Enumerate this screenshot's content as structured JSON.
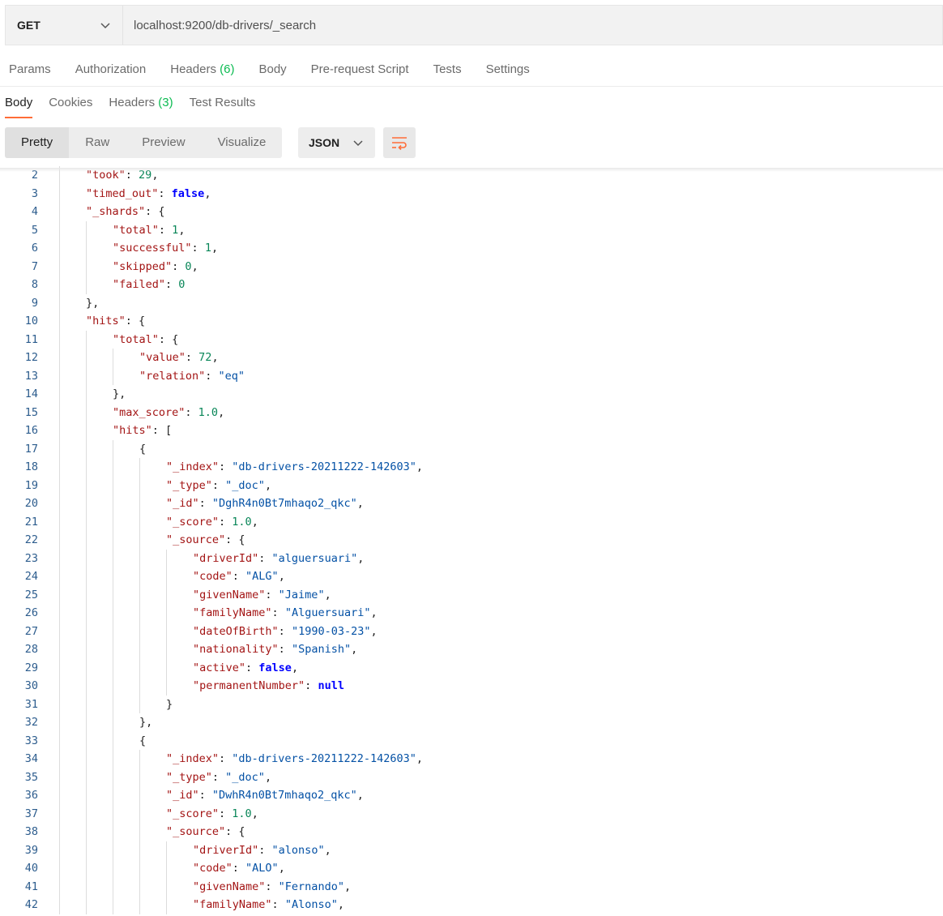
{
  "request": {
    "method": "GET",
    "url": "localhost:9200/db-drivers/_search",
    "tabs": [
      {
        "label": "Params",
        "count": ""
      },
      {
        "label": "Authorization",
        "count": ""
      },
      {
        "label": "Headers",
        "count": "(6)"
      },
      {
        "label": "Body",
        "count": ""
      },
      {
        "label": "Pre-request Script",
        "count": ""
      },
      {
        "label": "Tests",
        "count": ""
      },
      {
        "label": "Settings",
        "count": ""
      }
    ]
  },
  "response": {
    "tabs": [
      {
        "label": "Body",
        "count": "",
        "active": true
      },
      {
        "label": "Cookies",
        "count": "",
        "active": false
      },
      {
        "label": "Headers",
        "count": "(3)",
        "active": false
      },
      {
        "label": "Test Results",
        "count": "",
        "active": false
      }
    ],
    "views": [
      {
        "label": "Pretty",
        "active": true
      },
      {
        "label": "Raw",
        "active": false
      },
      {
        "label": "Preview",
        "active": false
      },
      {
        "label": "Visualize",
        "active": false
      }
    ],
    "format": "JSON"
  },
  "icons": {
    "method_dropdown": "chevron-down-icon",
    "format_dropdown": "chevron-down-icon",
    "wrap": "wrap-lines-icon"
  },
  "colors": {
    "accent": "#ff6c37",
    "count": "#0cbb52",
    "key": "#a31515",
    "string": "#0451a5",
    "number": "#098658",
    "keyword": "#0000ff",
    "line_number": "#2c5c8d"
  },
  "code_lines": [
    {
      "n": "2",
      "indent": 1,
      "tokens": [
        {
          "t": "k",
          "v": "\"took\""
        },
        {
          "t": "p",
          "v": ": "
        },
        {
          "t": "n",
          "v": "29"
        },
        {
          "t": "p",
          "v": ","
        }
      ]
    },
    {
      "n": "3",
      "indent": 1,
      "tokens": [
        {
          "t": "k",
          "v": "\"timed_out\""
        },
        {
          "t": "p",
          "v": ": "
        },
        {
          "t": "b",
          "v": "false"
        },
        {
          "t": "p",
          "v": ","
        }
      ]
    },
    {
      "n": "4",
      "indent": 1,
      "tokens": [
        {
          "t": "k",
          "v": "\"_shards\""
        },
        {
          "t": "p",
          "v": ": {"
        }
      ]
    },
    {
      "n": "5",
      "indent": 2,
      "tokens": [
        {
          "t": "k",
          "v": "\"total\""
        },
        {
          "t": "p",
          "v": ": "
        },
        {
          "t": "n",
          "v": "1"
        },
        {
          "t": "p",
          "v": ","
        }
      ]
    },
    {
      "n": "6",
      "indent": 2,
      "tokens": [
        {
          "t": "k",
          "v": "\"successful\""
        },
        {
          "t": "p",
          "v": ": "
        },
        {
          "t": "n",
          "v": "1"
        },
        {
          "t": "p",
          "v": ","
        }
      ]
    },
    {
      "n": "7",
      "indent": 2,
      "tokens": [
        {
          "t": "k",
          "v": "\"skipped\""
        },
        {
          "t": "p",
          "v": ": "
        },
        {
          "t": "n",
          "v": "0"
        },
        {
          "t": "p",
          "v": ","
        }
      ]
    },
    {
      "n": "8",
      "indent": 2,
      "tokens": [
        {
          "t": "k",
          "v": "\"failed\""
        },
        {
          "t": "p",
          "v": ": "
        },
        {
          "t": "n",
          "v": "0"
        }
      ]
    },
    {
      "n": "9",
      "indent": 1,
      "tokens": [
        {
          "t": "p",
          "v": "},"
        }
      ]
    },
    {
      "n": "10",
      "indent": 1,
      "tokens": [
        {
          "t": "k",
          "v": "\"hits\""
        },
        {
          "t": "p",
          "v": ": {"
        }
      ]
    },
    {
      "n": "11",
      "indent": 2,
      "tokens": [
        {
          "t": "k",
          "v": "\"total\""
        },
        {
          "t": "p",
          "v": ": {"
        }
      ]
    },
    {
      "n": "12",
      "indent": 3,
      "tokens": [
        {
          "t": "k",
          "v": "\"value\""
        },
        {
          "t": "p",
          "v": ": "
        },
        {
          "t": "n",
          "v": "72"
        },
        {
          "t": "p",
          "v": ","
        }
      ]
    },
    {
      "n": "13",
      "indent": 3,
      "tokens": [
        {
          "t": "k",
          "v": "\"relation\""
        },
        {
          "t": "p",
          "v": ": "
        },
        {
          "t": "s",
          "v": "\"eq\""
        }
      ]
    },
    {
      "n": "14",
      "indent": 2,
      "tokens": [
        {
          "t": "p",
          "v": "},"
        }
      ]
    },
    {
      "n": "15",
      "indent": 2,
      "tokens": [
        {
          "t": "k",
          "v": "\"max_score\""
        },
        {
          "t": "p",
          "v": ": "
        },
        {
          "t": "n",
          "v": "1.0"
        },
        {
          "t": "p",
          "v": ","
        }
      ]
    },
    {
      "n": "16",
      "indent": 2,
      "tokens": [
        {
          "t": "k",
          "v": "\"hits\""
        },
        {
          "t": "p",
          "v": ": ["
        }
      ]
    },
    {
      "n": "17",
      "indent": 3,
      "tokens": [
        {
          "t": "p",
          "v": "{"
        }
      ]
    },
    {
      "n": "18",
      "indent": 4,
      "tokens": [
        {
          "t": "k",
          "v": "\"_index\""
        },
        {
          "t": "p",
          "v": ": "
        },
        {
          "t": "s",
          "v": "\"db-drivers-20211222-142603\""
        },
        {
          "t": "p",
          "v": ","
        }
      ]
    },
    {
      "n": "19",
      "indent": 4,
      "tokens": [
        {
          "t": "k",
          "v": "\"_type\""
        },
        {
          "t": "p",
          "v": ": "
        },
        {
          "t": "s",
          "v": "\"_doc\""
        },
        {
          "t": "p",
          "v": ","
        }
      ]
    },
    {
      "n": "20",
      "indent": 4,
      "tokens": [
        {
          "t": "k",
          "v": "\"_id\""
        },
        {
          "t": "p",
          "v": ": "
        },
        {
          "t": "s",
          "v": "\"DghR4n0Bt7mhaqo2_qkc\""
        },
        {
          "t": "p",
          "v": ","
        }
      ]
    },
    {
      "n": "21",
      "indent": 4,
      "tokens": [
        {
          "t": "k",
          "v": "\"_score\""
        },
        {
          "t": "p",
          "v": ": "
        },
        {
          "t": "n",
          "v": "1.0"
        },
        {
          "t": "p",
          "v": ","
        }
      ]
    },
    {
      "n": "22",
      "indent": 4,
      "tokens": [
        {
          "t": "k",
          "v": "\"_source\""
        },
        {
          "t": "p",
          "v": ": {"
        }
      ]
    },
    {
      "n": "23",
      "indent": 5,
      "tokens": [
        {
          "t": "k",
          "v": "\"driverId\""
        },
        {
          "t": "p",
          "v": ": "
        },
        {
          "t": "s",
          "v": "\"alguersuari\""
        },
        {
          "t": "p",
          "v": ","
        }
      ]
    },
    {
      "n": "24",
      "indent": 5,
      "tokens": [
        {
          "t": "k",
          "v": "\"code\""
        },
        {
          "t": "p",
          "v": ": "
        },
        {
          "t": "s",
          "v": "\"ALG\""
        },
        {
          "t": "p",
          "v": ","
        }
      ]
    },
    {
      "n": "25",
      "indent": 5,
      "tokens": [
        {
          "t": "k",
          "v": "\"givenName\""
        },
        {
          "t": "p",
          "v": ": "
        },
        {
          "t": "s",
          "v": "\"Jaime\""
        },
        {
          "t": "p",
          "v": ","
        }
      ]
    },
    {
      "n": "26",
      "indent": 5,
      "tokens": [
        {
          "t": "k",
          "v": "\"familyName\""
        },
        {
          "t": "p",
          "v": ": "
        },
        {
          "t": "s",
          "v": "\"Alguersuari\""
        },
        {
          "t": "p",
          "v": ","
        }
      ]
    },
    {
      "n": "27",
      "indent": 5,
      "tokens": [
        {
          "t": "k",
          "v": "\"dateOfBirth\""
        },
        {
          "t": "p",
          "v": ": "
        },
        {
          "t": "s",
          "v": "\"1990-03-23\""
        },
        {
          "t": "p",
          "v": ","
        }
      ]
    },
    {
      "n": "28",
      "indent": 5,
      "tokens": [
        {
          "t": "k",
          "v": "\"nationality\""
        },
        {
          "t": "p",
          "v": ": "
        },
        {
          "t": "s",
          "v": "\"Spanish\""
        },
        {
          "t": "p",
          "v": ","
        }
      ]
    },
    {
      "n": "29",
      "indent": 5,
      "tokens": [
        {
          "t": "k",
          "v": "\"active\""
        },
        {
          "t": "p",
          "v": ": "
        },
        {
          "t": "b",
          "v": "false"
        },
        {
          "t": "p",
          "v": ","
        }
      ]
    },
    {
      "n": "30",
      "indent": 5,
      "tokens": [
        {
          "t": "k",
          "v": "\"permanentNumber\""
        },
        {
          "t": "p",
          "v": ": "
        },
        {
          "t": "b",
          "v": "null"
        }
      ]
    },
    {
      "n": "31",
      "indent": 4,
      "tokens": [
        {
          "t": "p",
          "v": "}"
        }
      ]
    },
    {
      "n": "32",
      "indent": 3,
      "tokens": [
        {
          "t": "p",
          "v": "},"
        }
      ]
    },
    {
      "n": "33",
      "indent": 3,
      "tokens": [
        {
          "t": "p",
          "v": "{"
        }
      ]
    },
    {
      "n": "34",
      "indent": 4,
      "tokens": [
        {
          "t": "k",
          "v": "\"_index\""
        },
        {
          "t": "p",
          "v": ": "
        },
        {
          "t": "s",
          "v": "\"db-drivers-20211222-142603\""
        },
        {
          "t": "p",
          "v": ","
        }
      ]
    },
    {
      "n": "35",
      "indent": 4,
      "tokens": [
        {
          "t": "k",
          "v": "\"_type\""
        },
        {
          "t": "p",
          "v": ": "
        },
        {
          "t": "s",
          "v": "\"_doc\""
        },
        {
          "t": "p",
          "v": ","
        }
      ]
    },
    {
      "n": "36",
      "indent": 4,
      "tokens": [
        {
          "t": "k",
          "v": "\"_id\""
        },
        {
          "t": "p",
          "v": ": "
        },
        {
          "t": "s",
          "v": "\"DwhR4n0Bt7mhaqo2_qkc\""
        },
        {
          "t": "p",
          "v": ","
        }
      ]
    },
    {
      "n": "37",
      "indent": 4,
      "tokens": [
        {
          "t": "k",
          "v": "\"_score\""
        },
        {
          "t": "p",
          "v": ": "
        },
        {
          "t": "n",
          "v": "1.0"
        },
        {
          "t": "p",
          "v": ","
        }
      ]
    },
    {
      "n": "38",
      "indent": 4,
      "tokens": [
        {
          "t": "k",
          "v": "\"_source\""
        },
        {
          "t": "p",
          "v": ": {"
        }
      ]
    },
    {
      "n": "39",
      "indent": 5,
      "tokens": [
        {
          "t": "k",
          "v": "\"driverId\""
        },
        {
          "t": "p",
          "v": ": "
        },
        {
          "t": "s",
          "v": "\"alonso\""
        },
        {
          "t": "p",
          "v": ","
        }
      ]
    },
    {
      "n": "40",
      "indent": 5,
      "tokens": [
        {
          "t": "k",
          "v": "\"code\""
        },
        {
          "t": "p",
          "v": ": "
        },
        {
          "t": "s",
          "v": "\"ALO\""
        },
        {
          "t": "p",
          "v": ","
        }
      ]
    },
    {
      "n": "41",
      "indent": 5,
      "tokens": [
        {
          "t": "k",
          "v": "\"givenName\""
        },
        {
          "t": "p",
          "v": ": "
        },
        {
          "t": "s",
          "v": "\"Fernando\""
        },
        {
          "t": "p",
          "v": ","
        }
      ]
    },
    {
      "n": "42",
      "indent": 5,
      "tokens": [
        {
          "t": "k",
          "v": "\"familyName\""
        },
        {
          "t": "p",
          "v": ": "
        },
        {
          "t": "s",
          "v": "\"Alonso\""
        },
        {
          "t": "p",
          "v": ","
        }
      ]
    }
  ]
}
